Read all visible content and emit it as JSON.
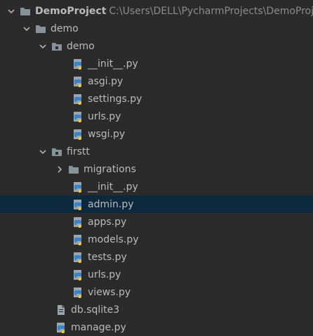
{
  "project": {
    "root_name": "DemoProject",
    "root_path": "C:\\Users\\DELL\\PycharmProjects\\DemoProjec"
  },
  "tree": {
    "demo_folder": "demo",
    "demo_pkg": "demo",
    "demo_files": [
      "__init__.py",
      "asgi.py",
      "settings.py",
      "urls.py",
      "wsgi.py"
    ],
    "firstt_pkg": "firstt",
    "migrations": "migrations",
    "firstt_files": [
      "__init__.py",
      "admin.py",
      "apps.py",
      "models.py",
      "tests.py",
      "urls.py",
      "views.py"
    ],
    "db_file": "db.sqlite3",
    "manage_file": "manage.py"
  },
  "selected": "admin.py",
  "colors": {
    "background": "#2b2b2b",
    "selection": "#0d293e",
    "text": "#bbbbbb",
    "path": "#8c8c8c"
  },
  "icons": {
    "expanded": "chevron-down-icon",
    "collapsed": "chevron-right-icon",
    "folder": "folder-icon",
    "package": "package-folder-icon",
    "python_file": "python-file-icon",
    "db_file": "db-file-icon"
  }
}
